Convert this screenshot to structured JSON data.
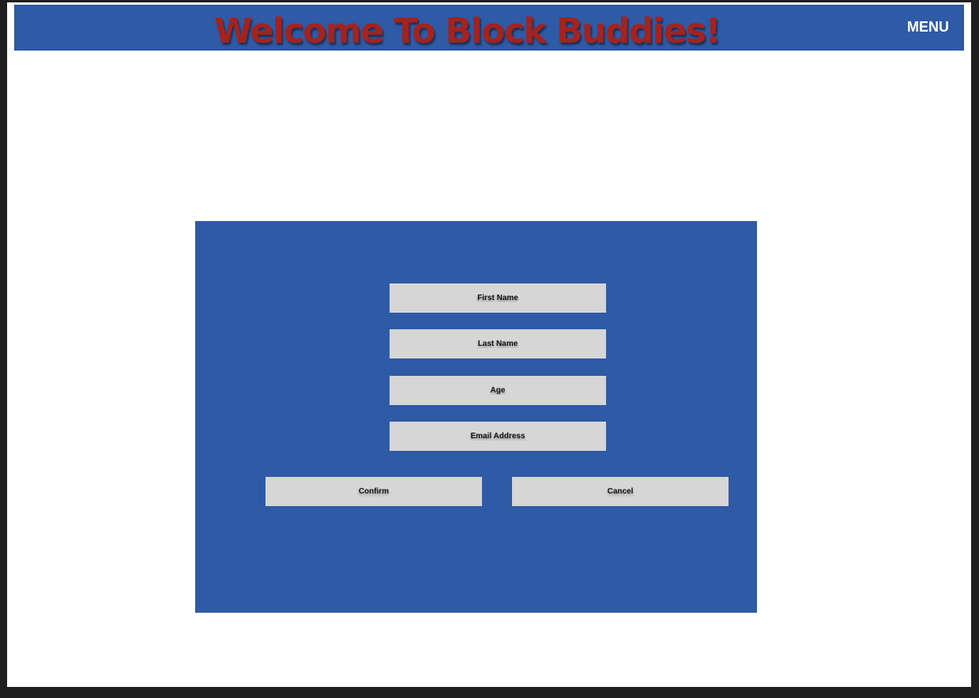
{
  "header": {
    "title": "Welcome To Block Buddies!",
    "menu_label": "MENU"
  },
  "form": {
    "fields": [
      {
        "placeholder": "First Name"
      },
      {
        "placeholder": "Last Name"
      },
      {
        "placeholder": "Age"
      },
      {
        "placeholder": "Email Address"
      }
    ],
    "confirm_label": "Confirm",
    "cancel_label": "Cancel"
  },
  "colors": {
    "header_bg": "#2f5aa5",
    "title_text": "#a3231f",
    "panel_bg": "#2f5aa5",
    "field_bg": "#d6d6d6",
    "page_bg": "#ffffff",
    "frame_bg": "#1e1e1e"
  }
}
